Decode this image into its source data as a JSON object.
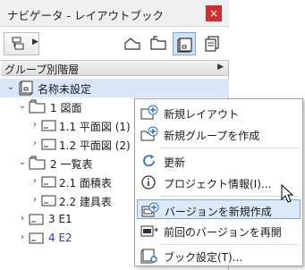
{
  "window": {
    "title": "ナビゲータ - レイアウトブック",
    "close_glyph": "×"
  },
  "toolbar": {
    "menu_arrow": "▶",
    "buttons": [
      {
        "name": "project-map-icon"
      },
      {
        "name": "view-map-icon"
      },
      {
        "name": "layout-book-icon",
        "active": true
      },
      {
        "name": "publisher-sets-icon"
      }
    ]
  },
  "group_bar": {
    "label": "グループ別階層",
    "arrow": "▶"
  },
  "tree": {
    "rows": [
      {
        "level": 0,
        "expander": "⌄",
        "icon": "book-icon",
        "label": "名称未設定",
        "selected": true
      },
      {
        "level": 1,
        "expander": "⌄",
        "icon": "folder-icon",
        "label": "1 図面"
      },
      {
        "level": 2,
        "expander": "›",
        "icon": "layout-icon",
        "label": "1.1 平面図 (1)"
      },
      {
        "level": 2,
        "expander": "›",
        "icon": "layout-icon",
        "label": "1.2 平面図 (2)"
      },
      {
        "level": 1,
        "expander": "⌄",
        "icon": "folder-icon",
        "label": "2 一覧表"
      },
      {
        "level": 2,
        "expander": "›",
        "icon": "layout-icon",
        "label": "2.1 面積表"
      },
      {
        "level": 2,
        "expander": "›",
        "icon": "layout-icon",
        "label": "2.2 建具表"
      },
      {
        "level": 1,
        "expander": "›",
        "icon": "layout-icon",
        "label": "3 E1"
      },
      {
        "level": 1,
        "expander": "›",
        "icon": "layout-icon",
        "label": "4 E2",
        "blue": true
      }
    ]
  },
  "context_menu": {
    "items": [
      {
        "icon": "new-layout-icon",
        "label": "新規レイアウト"
      },
      {
        "icon": "new-group-icon",
        "label": "新規グループを作成"
      },
      {
        "separator": true
      },
      {
        "icon": "refresh-icon",
        "label": "更新"
      },
      {
        "icon": "info-icon",
        "label": "プロジェクト情報(I)..."
      },
      {
        "separator": true
      },
      {
        "icon": "new-version-icon",
        "label": "バージョンを新規作成",
        "highlighted": true
      },
      {
        "icon": "resume-version-icon",
        "label": "前回のバージョンを再開"
      },
      {
        "separator": true
      },
      {
        "icon": "book-settings-icon",
        "label": "ブック設定(T)..."
      }
    ]
  },
  "colors": {
    "selection": "#d8e6f7",
    "highlight": "#dce9f8",
    "close": "#c8312f",
    "link_blue": "#1d3fbb"
  }
}
